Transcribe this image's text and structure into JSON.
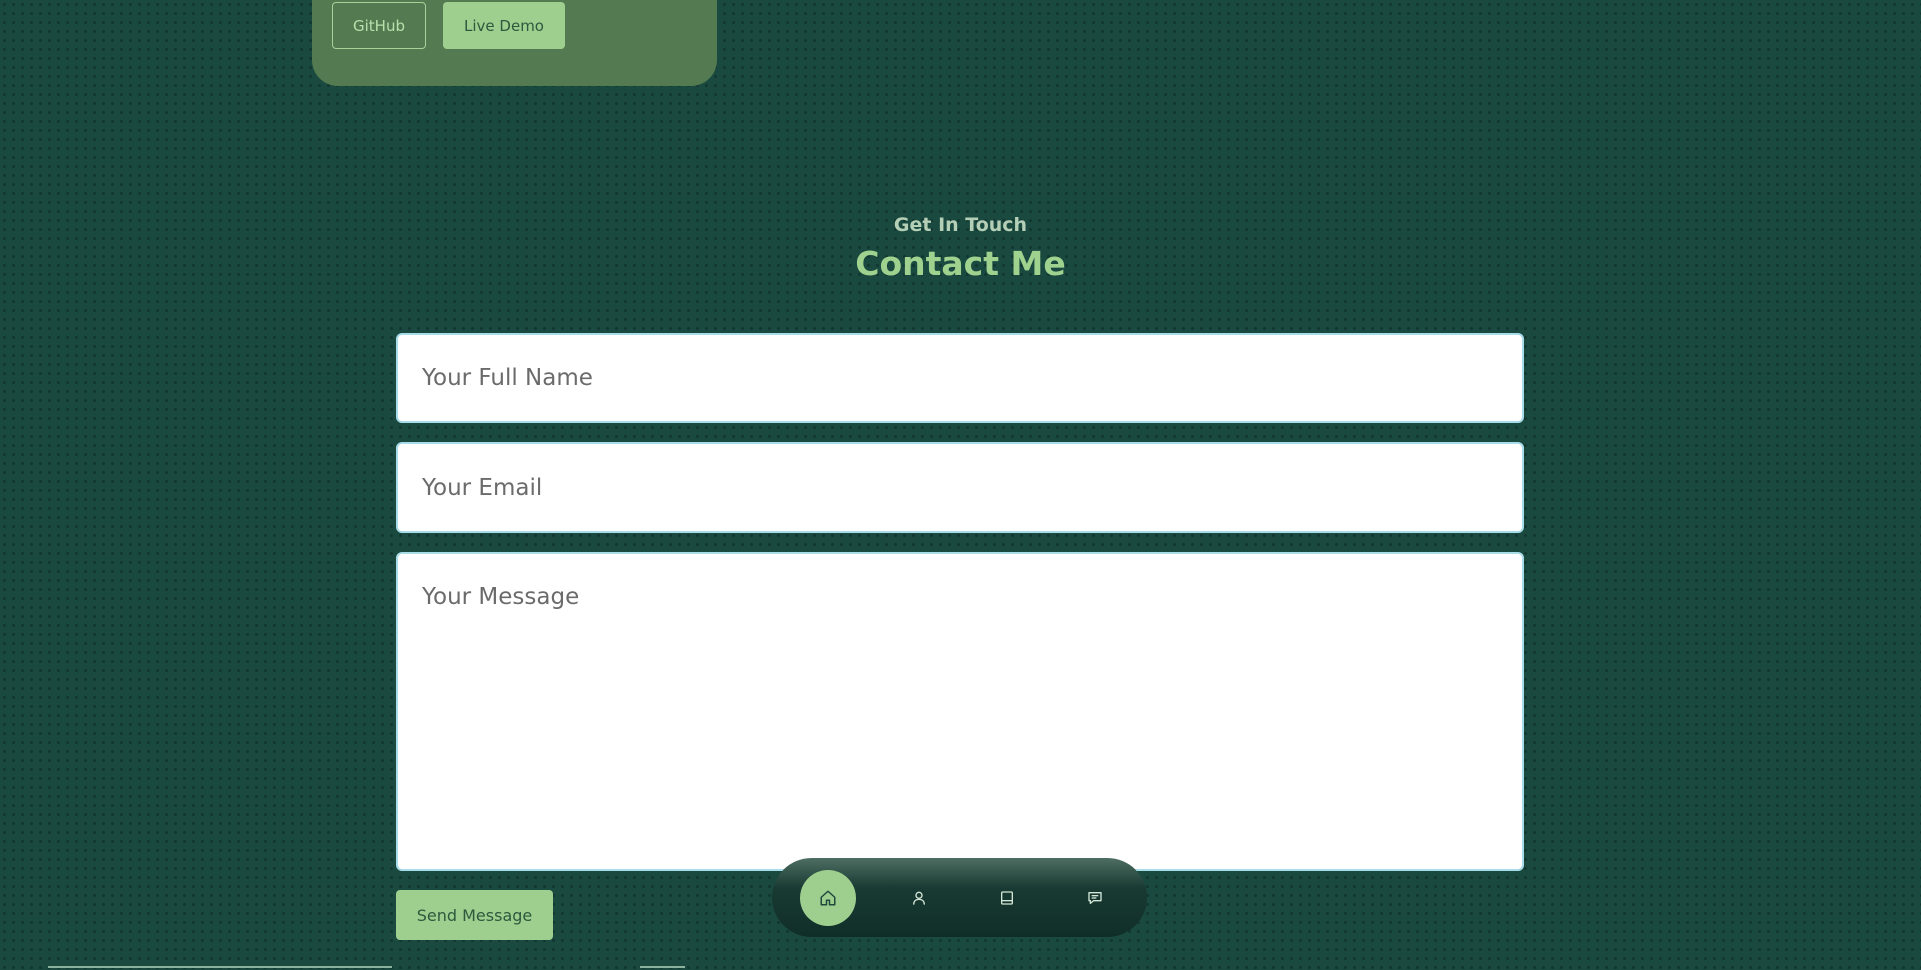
{
  "project_card": {
    "github_label": "GitHub",
    "demo_label": "Live Demo"
  },
  "contact": {
    "subtitle": "Get In Touch",
    "title": "Contact Me",
    "name_placeholder": "Your Full Name",
    "email_placeholder": "Your Email",
    "message_placeholder": "Your Message",
    "send_label": "Send Message"
  },
  "dock": {
    "items": [
      {
        "icon": "home-icon",
        "active": true
      },
      {
        "icon": "user-icon",
        "active": false
      },
      {
        "icon": "book-icon",
        "active": false
      },
      {
        "icon": "message-icon",
        "active": false
      }
    ]
  },
  "colors": {
    "background": "#1a4940",
    "accent": "#9fcf8f",
    "card": "#537a50"
  }
}
